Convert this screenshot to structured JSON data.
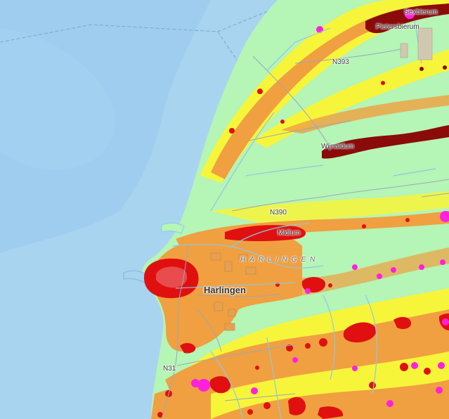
{
  "map": {
    "colors": {
      "sea": "#a8d4f0",
      "sea_deep": "#9ecbed",
      "land": "#b5f5b5",
      "band_yellow": "#f7f53a",
      "band_orange": "#f0a040",
      "hotspot_red": "#e01010",
      "hotspot_darkred": "#8b0a0a",
      "hotspot_magenta": "#ff20e0",
      "water_lines": "#8cc8e8",
      "roads": "#9aa8b8"
    },
    "labels": {
      "sexbierum": "Sexbierum",
      "pietersbierum": "Pietersbierum",
      "n393": "N393",
      "wijnaldum": "Wijnaldum",
      "n390": "N390",
      "midlum": "Midlum",
      "harlingen_area": "HARLINGEN",
      "harlingen": "Harlingen",
      "n31": "N31"
    }
  }
}
